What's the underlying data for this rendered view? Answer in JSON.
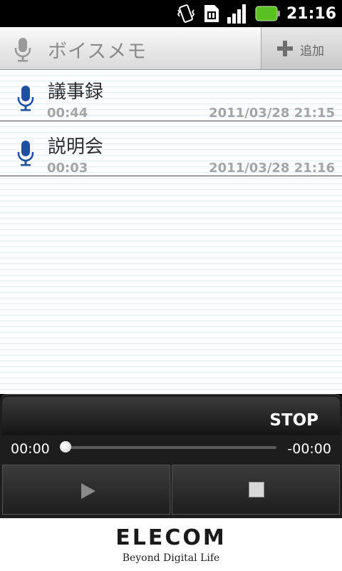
{
  "status_bar": {
    "time": "21:16",
    "icons": [
      "vibrate-icon",
      "sim-card-icon",
      "signal-icon",
      "battery-icon"
    ]
  },
  "app_header": {
    "title": "ボイスメモ",
    "add_label": "追加"
  },
  "recordings": [
    {
      "title": "議事録",
      "duration": "00:44",
      "datetime": "2011/03/28 21:15"
    },
    {
      "title": "説明会",
      "duration": "00:03",
      "datetime": "2011/03/28 21:16"
    }
  ],
  "player": {
    "state_label": "STOP",
    "elapsed": "00:00",
    "remaining": "-00:00",
    "progress": 0
  },
  "footer": {
    "brand": "ELECOM",
    "tagline": "Beyond Digital Life"
  },
  "colors": {
    "mic_accent": "#1f4fa3",
    "list_line": "#e4eef9"
  }
}
